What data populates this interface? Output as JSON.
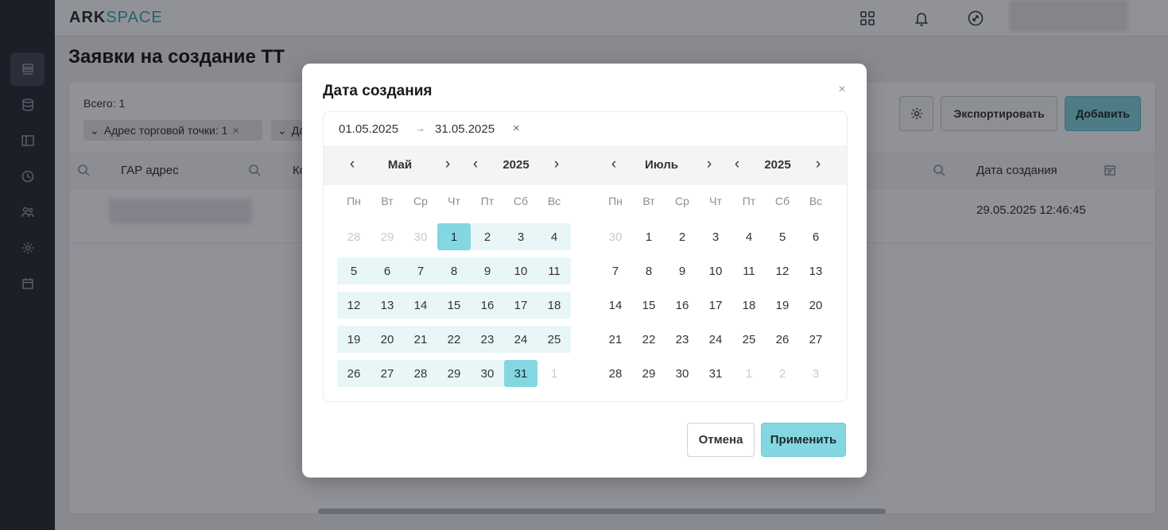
{
  "app": {
    "logo_bold": "ARK",
    "logo_light": "SPACE"
  },
  "page": {
    "title": "Заявки на создание ТТ"
  },
  "panel": {
    "total": "Всего: 1",
    "chips": [
      "Адрес торговой точки: 1",
      "Да"
    ],
    "toolbar": {
      "export_label": "Экспортировать",
      "add_label": "Добавить"
    }
  },
  "table": {
    "headers": [
      "ГАР адрес",
      "Ко",
      "Дата создания"
    ],
    "row": {
      "created_at": "29.05.2025 12:46:45"
    }
  },
  "modal": {
    "title": "Дата создания",
    "range_start": "01.05.2025",
    "range_arrow": "→",
    "range_end": "31.05.2025",
    "apply_label": "Применить",
    "cancel_label": "Отмена"
  },
  "calendar": {
    "weekdays": [
      "Пн",
      "Вт",
      "Ср",
      "Чт",
      "Пт",
      "Сб",
      "Вс"
    ],
    "months": [
      {
        "month": "Май",
        "year": "2025",
        "weeks": [
          [
            {
              "d": "28",
              "s": "muted"
            },
            {
              "d": "29",
              "s": "muted"
            },
            {
              "d": "30",
              "s": "muted"
            },
            {
              "d": "1",
              "s": "selected"
            },
            {
              "d": "2",
              "s": "inrange"
            },
            {
              "d": "3",
              "s": "inrange"
            },
            {
              "d": "4",
              "s": "inrange"
            }
          ],
          [
            {
              "d": "5",
              "s": "inrange"
            },
            {
              "d": "6",
              "s": "inrange"
            },
            {
              "d": "7",
              "s": "inrange"
            },
            {
              "d": "8",
              "s": "inrange"
            },
            {
              "d": "9",
              "s": "inrange"
            },
            {
              "d": "10",
              "s": "inrange"
            },
            {
              "d": "11",
              "s": "inrange"
            }
          ],
          [
            {
              "d": "12",
              "s": "inrange"
            },
            {
              "d": "13",
              "s": "inrange"
            },
            {
              "d": "14",
              "s": "inrange"
            },
            {
              "d": "15",
              "s": "inrange"
            },
            {
              "d": "16",
              "s": "inrange"
            },
            {
              "d": "17",
              "s": "inrange"
            },
            {
              "d": "18",
              "s": "inrange"
            }
          ],
          [
            {
              "d": "19",
              "s": "inrange"
            },
            {
              "d": "20",
              "s": "inrange"
            },
            {
              "d": "21",
              "s": "inrange"
            },
            {
              "d": "22",
              "s": "inrange"
            },
            {
              "d": "23",
              "s": "inrange"
            },
            {
              "d": "24",
              "s": "inrange"
            },
            {
              "d": "25",
              "s": "inrange"
            }
          ],
          [
            {
              "d": "26",
              "s": "inrange"
            },
            {
              "d": "27",
              "s": "inrange"
            },
            {
              "d": "28",
              "s": "inrange"
            },
            {
              "d": "29",
              "s": "inrange"
            },
            {
              "d": "30",
              "s": "inrange"
            },
            {
              "d": "31",
              "s": "selected"
            },
            {
              "d": "1",
              "s": "muted"
            }
          ]
        ]
      },
      {
        "month": "Июль",
        "year": "2025",
        "weeks": [
          [
            {
              "d": "30",
              "s": "muted"
            },
            {
              "d": "1",
              "s": ""
            },
            {
              "d": "2",
              "s": ""
            },
            {
              "d": "3",
              "s": ""
            },
            {
              "d": "4",
              "s": ""
            },
            {
              "d": "5",
              "s": ""
            },
            {
              "d": "6",
              "s": ""
            }
          ],
          [
            {
              "d": "7",
              "s": ""
            },
            {
              "d": "8",
              "s": ""
            },
            {
              "d": "9",
              "s": ""
            },
            {
              "d": "10",
              "s": ""
            },
            {
              "d": "11",
              "s": ""
            },
            {
              "d": "12",
              "s": ""
            },
            {
              "d": "13",
              "s": ""
            }
          ],
          [
            {
              "d": "14",
              "s": ""
            },
            {
              "d": "15",
              "s": ""
            },
            {
              "d": "16",
              "s": ""
            },
            {
              "d": "17",
              "s": ""
            },
            {
              "d": "18",
              "s": ""
            },
            {
              "d": "19",
              "s": ""
            },
            {
              "d": "20",
              "s": ""
            }
          ],
          [
            {
              "d": "21",
              "s": ""
            },
            {
              "d": "22",
              "s": ""
            },
            {
              "d": "23",
              "s": ""
            },
            {
              "d": "24",
              "s": ""
            },
            {
              "d": "25",
              "s": ""
            },
            {
              "d": "26",
              "s": ""
            },
            {
              "d": "27",
              "s": ""
            }
          ],
          [
            {
              "d": "28",
              "s": ""
            },
            {
              "d": "29",
              "s": ""
            },
            {
              "d": "30",
              "s": ""
            },
            {
              "d": "31",
              "s": ""
            },
            {
              "d": "1",
              "s": "muted"
            },
            {
              "d": "2",
              "s": "muted"
            },
            {
              "d": "3",
              "s": "muted"
            }
          ]
        ]
      }
    ]
  },
  "colors": {
    "accent": "#84d7e0",
    "range": "#e8f6f7",
    "rail": "#2b2e36"
  }
}
